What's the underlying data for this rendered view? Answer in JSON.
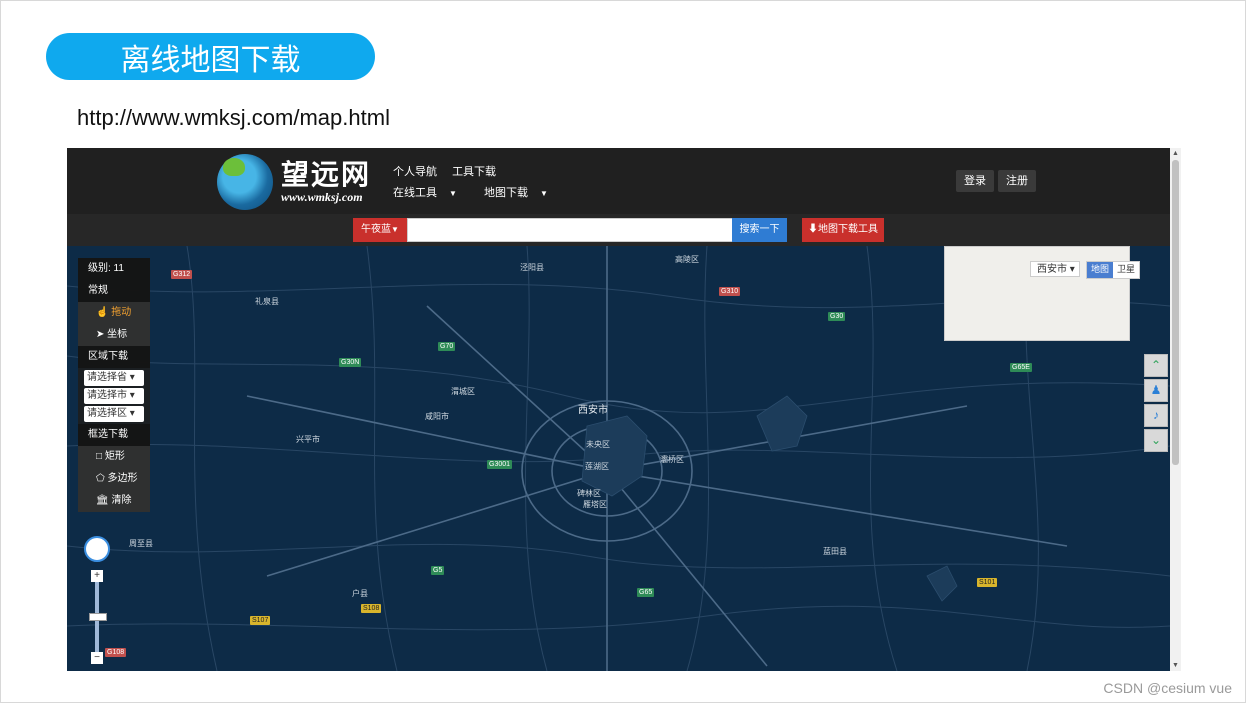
{
  "slide": {
    "title": "离线地图下载",
    "url": "http://www.wmksj.com/map.html",
    "watermark": "CSDN @cesium vue"
  },
  "site": {
    "logo_cn": "望远网",
    "logo_url": "www.wmksj.com",
    "nav_row1": [
      "个人导航",
      "工具下载"
    ],
    "nav_row2": [
      "在线工具",
      "地图下载"
    ],
    "login": "登录",
    "register": "注册",
    "theme_button": "午夜蓝",
    "search_button": "搜索一下",
    "download_tool_button": "地图下载工具"
  },
  "panel": {
    "level": "级别: 11",
    "general": "常规",
    "drag": "拖动",
    "coords": "坐标",
    "area_download": "区域下载",
    "province_select": "请选择省",
    "city_select": "请选择市",
    "district_select": "请选择区",
    "box_download": "框选下载",
    "rect": "矩形",
    "polygon": "多边形",
    "clear": "清除"
  },
  "map_controls": {
    "city": "西安市",
    "map_type": "地图",
    "satellite_type": "卫星"
  },
  "map_labels": {
    "cities": [
      "西安市",
      "咸阳市",
      "蓝田县",
      "未央区",
      "莲湖区",
      "碑林区",
      "雁塔区",
      "灞桥区",
      "高陵区",
      "泾阳县",
      "礼泉县",
      "兴平市",
      "户县",
      "周至县",
      "渭城区"
    ],
    "roads": [
      "G312",
      "G310",
      "G30",
      "G30N",
      "G70",
      "G3001",
      "G65E",
      "G5",
      "G65",
      "S108",
      "S107",
      "S101",
      "G108"
    ]
  },
  "icons": {
    "drag_icon": "hand-icon",
    "coords_icon": "location-arrow-icon",
    "rect_icon": "square-icon",
    "polygon_icon": "polygon-icon",
    "clear_icon": "bank-icon",
    "side_up": "chevron-up-icon",
    "side_qq": "qq-icon",
    "side_tiktok": "tiktok-icon",
    "side_down": "chevron-down-icon"
  },
  "colors": {
    "pill": "#0fa9ee",
    "map_bg": "#0d2b47",
    "topbar": "#202020",
    "red_button": "#c9302c",
    "blue_button": "#2f7cd3"
  }
}
